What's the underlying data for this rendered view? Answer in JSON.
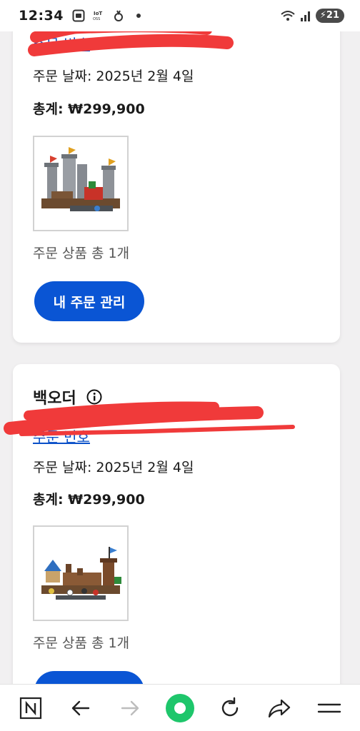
{
  "status_bar": {
    "time": "12:34",
    "battery": "21",
    "icons": [
      "screenshot-icon",
      "iot-icon",
      "fitness-icon",
      "dot-icon",
      "wifi-icon",
      "signal-icon",
      "battery-icon"
    ]
  },
  "orders": [
    {
      "link_text": "주문 번호",
      "date": "주문 날짜: 2025년 2월 4일",
      "total": "총계: ₩299,900",
      "item_count": "주문 상품 총 1개",
      "button_label": "내 주문 관리"
    },
    {
      "title": "백오더",
      "link_text": "주문 번호",
      "date": "주문 날짜: 2025년 2월 4일",
      "total": "총계: ₩299,900",
      "item_count": "주문 상품 총 1개"
    }
  ],
  "bottom_nav": [
    "naver-icon",
    "back-arrow-icon",
    "forward-arrow-icon",
    "home-circle-icon",
    "refresh-icon",
    "share-icon",
    "menu-icon"
  ],
  "colors": {
    "accent_blue": "#0a55d4",
    "link_blue": "#0a50c8",
    "redaction_red": "#f03a3a",
    "nav_green": "#1ec66b"
  }
}
